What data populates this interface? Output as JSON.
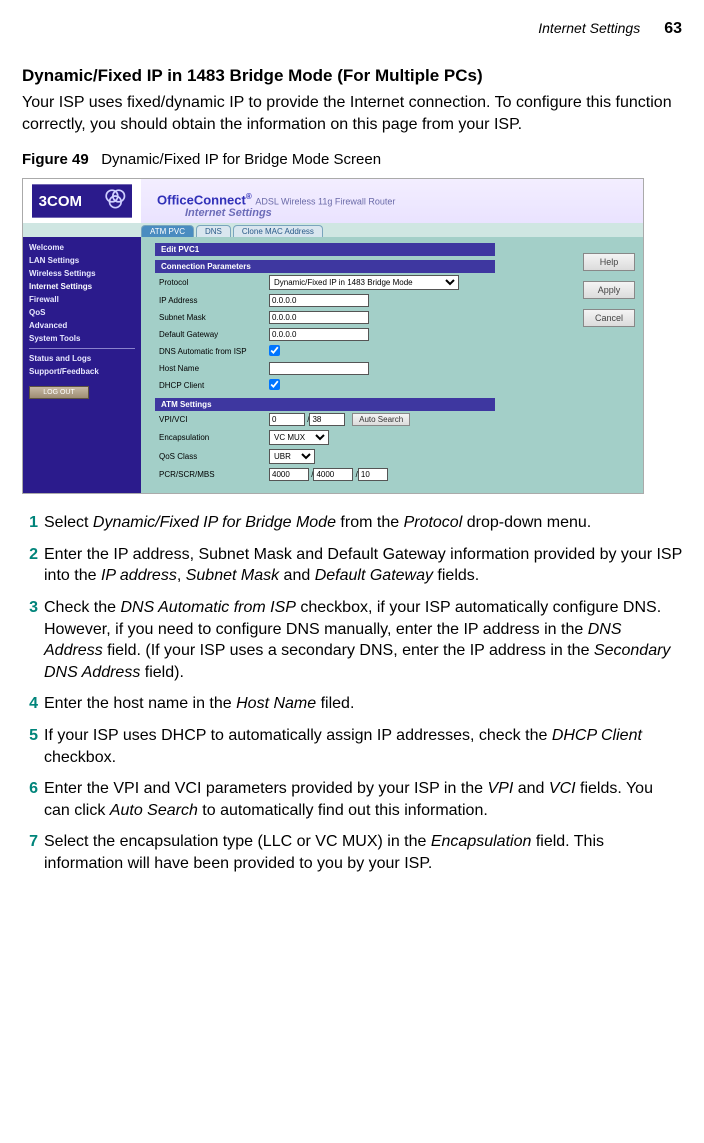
{
  "header": {
    "section": "Internet Settings",
    "page": "63"
  },
  "title": "Dynamic/Fixed IP in 1483 Bridge Mode (For Multiple PCs)",
  "intro": "Your ISP uses fixed/dynamic IP to provide the Internet connection. To configure this function correctly, you should obtain the information on this page from your ISP.",
  "figure": {
    "label": "Figure 49",
    "caption": "Dynamic/Fixed IP for Bridge Mode Screen"
  },
  "screenshot": {
    "brand": "OfficeConnect",
    "brand_tag": "ADSL Wireless 11g Firewall Router",
    "page_title": "Internet Settings",
    "tabs": [
      "ATM PVC",
      "DNS",
      "Clone MAC Address"
    ],
    "active_tab": 0,
    "nav": [
      "Welcome",
      "LAN Settings",
      "Wireless Settings",
      "Internet Settings",
      "Firewall",
      "QoS",
      "Advanced",
      "System Tools"
    ],
    "nav2": [
      "Status and Logs",
      "Support/Feedback"
    ],
    "active_nav": 3,
    "logout": "LOG OUT",
    "side_buttons": [
      "Help",
      "Apply",
      "Cancel"
    ],
    "edit_heading": "Edit PVC1",
    "section1": "Connection Parameters",
    "section2": "ATM Settings",
    "fields": {
      "protocol": {
        "label": "Protocol",
        "value": "Dynamic/Fixed IP in 1483 Bridge Mode"
      },
      "ip": {
        "label": "IP Address",
        "value": "0.0.0.0"
      },
      "subnet": {
        "label": "Subnet Mask",
        "value": "0.0.0.0"
      },
      "gateway": {
        "label": "Default Gateway",
        "value": "0.0.0.0"
      },
      "dns_auto": {
        "label": "DNS Automatic from ISP",
        "checked": true
      },
      "host": {
        "label": "Host Name",
        "value": ""
      },
      "dhcp": {
        "label": "DHCP Client",
        "checked": true
      },
      "vpivci": {
        "label": "VPI/VCI",
        "vpi": "0",
        "vci": "38",
        "button": "Auto Search"
      },
      "encap": {
        "label": "Encapsulation",
        "value": "VC MUX"
      },
      "qos": {
        "label": "QoS Class",
        "value": "UBR"
      },
      "pcr": {
        "label": "PCR/SCR/MBS",
        "pcr": "4000",
        "scr": "4000",
        "mbs": "10"
      }
    }
  },
  "steps": {
    "s1a": "Select ",
    "s1i": "Dynamic/Fixed IP for Bridge Mode",
    "s1b": " from the ",
    "s1j": "Protocol",
    "s1c": " drop-down menu.",
    "s2a": "Enter the IP address, Subnet Mask and Default Gateway information provided by your ISP into the ",
    "s2i": "IP address",
    "s2b": ", ",
    "s2j": "Subnet Mask",
    "s2c": " and ",
    "s2k": "Default Gateway",
    "s2d": " fields.",
    "s3a": "Check the ",
    "s3i": "DNS Automatic from ISP",
    "s3b": " checkbox, if your ISP automatically configure DNS. However, if you need to configure DNS manually, enter the IP address in the ",
    "s3j": "DNS Address",
    "s3c": " field. (If your ISP uses a secondary DNS, enter the IP address in the ",
    "s3k": "Secondary DNS Address",
    "s3d": " field).",
    "s4a": "Enter the host name in the ",
    "s4i": "Host Name",
    "s4b": " filed.",
    "s5a": "If your ISP uses DHCP to automatically assign IP addresses, check the ",
    "s5i": "DHCP Client",
    "s5b": " checkbox.",
    "s6a": "Enter the VPI and VCI parameters provided by your ISP in the ",
    "s6i": "VPI",
    "s6b": " and ",
    "s6j": "VCI",
    "s6c": " fields. You can click ",
    "s6k": "Auto Search",
    "s6d": " to automatically find out this information.",
    "s7a": "Select the encapsulation type (LLC or VC MUX) in the ",
    "s7i": "Encapsulation",
    "s7b": " field. This information will have been provided to you by your ISP."
  }
}
